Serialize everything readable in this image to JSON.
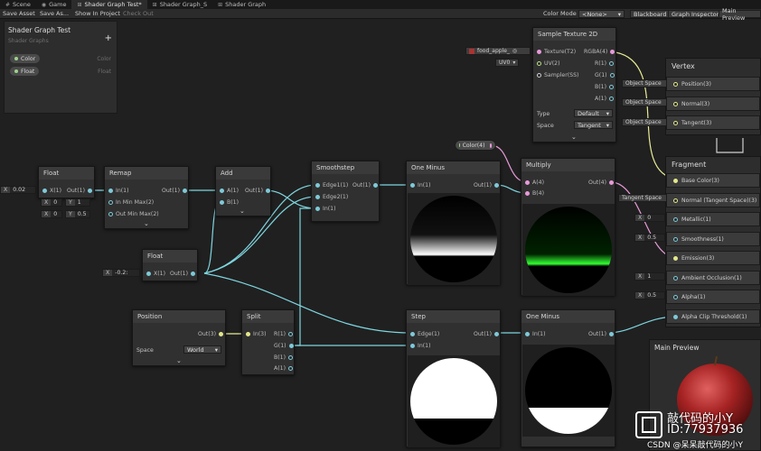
{
  "tabs": [
    {
      "label": "Scene",
      "icon": "hash-icon"
    },
    {
      "label": "Game",
      "icon": "gamepad-icon"
    },
    {
      "label": "Shader Graph Test*",
      "icon": "graph-icon"
    },
    {
      "label": "Shader Graph_S",
      "icon": "graph-icon"
    },
    {
      "label": "Shader Graph",
      "icon": "graph-icon"
    }
  ],
  "toolbar": {
    "save_asset": "Save Asset",
    "save_as": "Save As...",
    "show_in_project": "Show In Project",
    "check_out": "Check Out",
    "color_mode_label": "Color Mode",
    "color_mode_value": "<None>",
    "blackboard": "Blackboard",
    "graph_inspector": "Graph Inspector",
    "main_preview": "Main Preview"
  },
  "blackboard": {
    "title": "Shader Graph Test",
    "subtitle": "Shader Graphs",
    "properties": [
      {
        "name": "Color",
        "type": "Color"
      },
      {
        "name": "Float",
        "type": "Float"
      }
    ]
  },
  "nodes": {
    "float1": {
      "title": "Float",
      "in": "X(1)",
      "out": "Out(1)",
      "x_label": "X",
      "x_value": "0.02"
    },
    "remap": {
      "title": "Remap",
      "in1": "In(1)",
      "in2": "In Min Max(2)",
      "in3": "Out Min Max(2)",
      "out": "Out(1)",
      "x": "X",
      "y": "Y",
      "in_min": "0",
      "in_max": "1",
      "out_min": "0",
      "out_max": "0.5"
    },
    "add": {
      "title": "Add",
      "a": "A(1)",
      "b": "B(1)",
      "out": "Out(1)"
    },
    "smoothstep": {
      "title": "Smoothstep",
      "e1": "Edge1(1)",
      "e2": "Edge2(1)",
      "in": "In(1)",
      "out": "Out(1)"
    },
    "one_minus1": {
      "title": "One Minus",
      "in": "In(1)",
      "out": "Out(1)"
    },
    "multiply": {
      "title": "Multiply",
      "a": "A(4)",
      "b": "B(4)",
      "out": "Out(4)"
    },
    "color_prop": {
      "label": "Color(4)"
    },
    "float2": {
      "title": "Float",
      "in": "X(1)",
      "out": "Out(1)",
      "x_label": "X",
      "x_value": "-0.2:"
    },
    "position": {
      "title": "Position",
      "out": "Out(3)",
      "space_label": "Space",
      "space_value": "World"
    },
    "split": {
      "title": "Split",
      "in": "In(3)",
      "r": "R(1)",
      "g": "G(1)",
      "b": "B(1)",
      "a": "A(1)"
    },
    "step": {
      "title": "Step",
      "edge": "Edge(1)",
      "in": "In(1)",
      "out": "Out(1)"
    },
    "one_minus2": {
      "title": "One Minus",
      "in": "In(1)",
      "out": "Out(1)"
    },
    "sample_tex": {
      "title": "Sample Texture 2D",
      "tex": "Texture(T2)",
      "uv": "UV(2)",
      "sampler": "Sampler(SS)",
      "rgba": "RGBA(4)",
      "r": "R(1)",
      "g": "G(1)",
      "b": "B(1)",
      "a": "A(1)",
      "type_label": "Type",
      "type_value": "Default",
      "space_label": "Space",
      "space_value": "Tangent",
      "tex_input": "food_apple_",
      "uv_input": "UV0"
    }
  },
  "vertex": {
    "title": "Vertex",
    "rows": [
      "Position(3)",
      "Normal(3)",
      "Tangent(3)"
    ],
    "inputs": [
      "Object Space",
      "Object Space",
      "Object Space"
    ]
  },
  "fragment": {
    "title": "Fragment",
    "rows": [
      "Base Color(3)",
      "Normal (Tangent Space)(3)",
      "Metallic(1)",
      "Smoothness(1)",
      "Emission(3)",
      "Ambient Occlusion(1)",
      "Alpha(1)",
      "Alpha Clip Threshold(1)"
    ],
    "normal_input": "Tangent Space",
    "metallic_label": "X",
    "metallic_value": "0",
    "smooth_label": "X",
    "smooth_value": "0.5",
    "ao_label": "X",
    "ao_value": "1",
    "alpha_label": "X",
    "alpha_value": "0.5"
  },
  "main_preview": {
    "title": "Main Preview"
  },
  "watermark": {
    "line1": "敲代码的小Y",
    "line2": "ID:77937936",
    "line3": "CSDN @呆呆敲代码的小Y"
  },
  "colors": {
    "accent_wire": "#7ed6e0",
    "yellow_wire": "#e9ec95",
    "emission_green": "#33ff33",
    "apple_red": "#b52b2b"
  }
}
